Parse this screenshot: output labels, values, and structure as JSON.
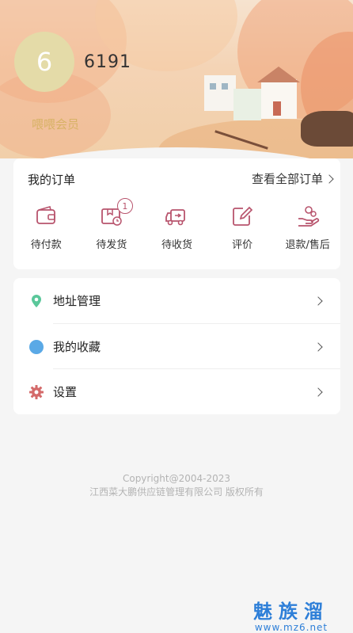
{
  "profile": {
    "avatar_char": "6",
    "username": "6191",
    "member_label": "喂喂会员"
  },
  "orders": {
    "title": "我的订单",
    "view_all": "查看全部订单",
    "items": [
      {
        "label": "待付款",
        "icon": "wallet-icon"
      },
      {
        "label": "待发货",
        "icon": "package-clock-icon",
        "badge": "1"
      },
      {
        "label": "待收货",
        "icon": "delivery-truck-icon"
      },
      {
        "label": "评价",
        "icon": "edit-review-icon"
      },
      {
        "label": "退款/售后",
        "icon": "refund-hand-icon"
      }
    ]
  },
  "menu": {
    "items": [
      {
        "label": "地址管理",
        "icon": "location-pin-icon"
      },
      {
        "label": "我的收藏",
        "icon": "favorite-dot-icon"
      },
      {
        "label": "设置",
        "icon": "gear-icon"
      }
    ]
  },
  "footer": {
    "copyright": "Copyright@2004-2023",
    "company": "江西菜大鹏供应链管理有限公司 版权所有"
  },
  "watermark": {
    "title": "魅族溜",
    "url": "www.mz6.net"
  },
  "colors": {
    "icon_accent": "#b8546d",
    "location_green": "#5ac79a",
    "favorite_blue": "#5aa9e6",
    "gear_red": "#d46a6a",
    "member_gold": "#d8b266",
    "avatar_bg": "#e4dba8",
    "watermark_blue": "#2e7fd8"
  }
}
